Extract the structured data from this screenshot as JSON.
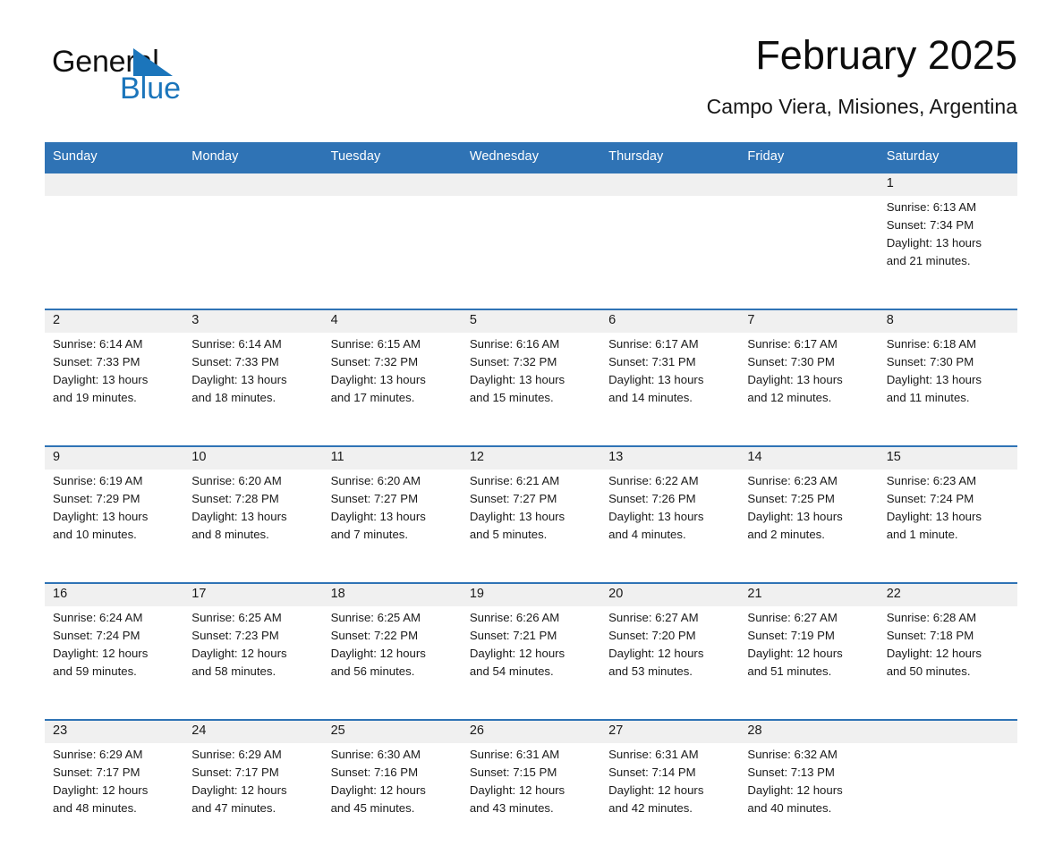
{
  "logo": {
    "word_one": "General",
    "word_two": "Blue",
    "triangle_icon": "triangle-icon",
    "brand_color": "#1b75bb"
  },
  "header": {
    "title": "February 2025",
    "subtitle": "Campo Viera, Misiones, Argentina"
  },
  "theme": {
    "header_blue": "#2f73b5",
    "daynum_strip": "#f0f0f0",
    "cell_background": "#ffffff"
  },
  "weekday_headers": [
    "Sunday",
    "Monday",
    "Tuesday",
    "Wednesday",
    "Thursday",
    "Friday",
    "Saturday"
  ],
  "weeks": [
    {
      "days": [
        {
          "num": "",
          "lines": []
        },
        {
          "num": "",
          "lines": []
        },
        {
          "num": "",
          "lines": []
        },
        {
          "num": "",
          "lines": []
        },
        {
          "num": "",
          "lines": []
        },
        {
          "num": "",
          "lines": []
        },
        {
          "num": "1",
          "lines": [
            "Sunrise: 6:13 AM",
            "Sunset: 7:34 PM",
            "Daylight: 13 hours",
            "and 21 minutes."
          ]
        }
      ]
    },
    {
      "days": [
        {
          "num": "2",
          "lines": [
            "Sunrise: 6:14 AM",
            "Sunset: 7:33 PM",
            "Daylight: 13 hours",
            "and 19 minutes."
          ]
        },
        {
          "num": "3",
          "lines": [
            "Sunrise: 6:14 AM",
            "Sunset: 7:33 PM",
            "Daylight: 13 hours",
            "and 18 minutes."
          ]
        },
        {
          "num": "4",
          "lines": [
            "Sunrise: 6:15 AM",
            "Sunset: 7:32 PM",
            "Daylight: 13 hours",
            "and 17 minutes."
          ]
        },
        {
          "num": "5",
          "lines": [
            "Sunrise: 6:16 AM",
            "Sunset: 7:32 PM",
            "Daylight: 13 hours",
            "and 15 minutes."
          ]
        },
        {
          "num": "6",
          "lines": [
            "Sunrise: 6:17 AM",
            "Sunset: 7:31 PM",
            "Daylight: 13 hours",
            "and 14 minutes."
          ]
        },
        {
          "num": "7",
          "lines": [
            "Sunrise: 6:17 AM",
            "Sunset: 7:30 PM",
            "Daylight: 13 hours",
            "and 12 minutes."
          ]
        },
        {
          "num": "8",
          "lines": [
            "Sunrise: 6:18 AM",
            "Sunset: 7:30 PM",
            "Daylight: 13 hours",
            "and 11 minutes."
          ]
        }
      ]
    },
    {
      "days": [
        {
          "num": "9",
          "lines": [
            "Sunrise: 6:19 AM",
            "Sunset: 7:29 PM",
            "Daylight: 13 hours",
            "and 10 minutes."
          ]
        },
        {
          "num": "10",
          "lines": [
            "Sunrise: 6:20 AM",
            "Sunset: 7:28 PM",
            "Daylight: 13 hours",
            "and 8 minutes."
          ]
        },
        {
          "num": "11",
          "lines": [
            "Sunrise: 6:20 AM",
            "Sunset: 7:27 PM",
            "Daylight: 13 hours",
            "and 7 minutes."
          ]
        },
        {
          "num": "12",
          "lines": [
            "Sunrise: 6:21 AM",
            "Sunset: 7:27 PM",
            "Daylight: 13 hours",
            "and 5 minutes."
          ]
        },
        {
          "num": "13",
          "lines": [
            "Sunrise: 6:22 AM",
            "Sunset: 7:26 PM",
            "Daylight: 13 hours",
            "and 4 minutes."
          ]
        },
        {
          "num": "14",
          "lines": [
            "Sunrise: 6:23 AM",
            "Sunset: 7:25 PM",
            "Daylight: 13 hours",
            "and 2 minutes."
          ]
        },
        {
          "num": "15",
          "lines": [
            "Sunrise: 6:23 AM",
            "Sunset: 7:24 PM",
            "Daylight: 13 hours",
            "and 1 minute."
          ]
        }
      ]
    },
    {
      "days": [
        {
          "num": "16",
          "lines": [
            "Sunrise: 6:24 AM",
            "Sunset: 7:24 PM",
            "Daylight: 12 hours",
            "and 59 minutes."
          ]
        },
        {
          "num": "17",
          "lines": [
            "Sunrise: 6:25 AM",
            "Sunset: 7:23 PM",
            "Daylight: 12 hours",
            "and 58 minutes."
          ]
        },
        {
          "num": "18",
          "lines": [
            "Sunrise: 6:25 AM",
            "Sunset: 7:22 PM",
            "Daylight: 12 hours",
            "and 56 minutes."
          ]
        },
        {
          "num": "19",
          "lines": [
            "Sunrise: 6:26 AM",
            "Sunset: 7:21 PM",
            "Daylight: 12 hours",
            "and 54 minutes."
          ]
        },
        {
          "num": "20",
          "lines": [
            "Sunrise: 6:27 AM",
            "Sunset: 7:20 PM",
            "Daylight: 12 hours",
            "and 53 minutes."
          ]
        },
        {
          "num": "21",
          "lines": [
            "Sunrise: 6:27 AM",
            "Sunset: 7:19 PM",
            "Daylight: 12 hours",
            "and 51 minutes."
          ]
        },
        {
          "num": "22",
          "lines": [
            "Sunrise: 6:28 AM",
            "Sunset: 7:18 PM",
            "Daylight: 12 hours",
            "and 50 minutes."
          ]
        }
      ]
    },
    {
      "days": [
        {
          "num": "23",
          "lines": [
            "Sunrise: 6:29 AM",
            "Sunset: 7:17 PM",
            "Daylight: 12 hours",
            "and 48 minutes."
          ]
        },
        {
          "num": "24",
          "lines": [
            "Sunrise: 6:29 AM",
            "Sunset: 7:17 PM",
            "Daylight: 12 hours",
            "and 47 minutes."
          ]
        },
        {
          "num": "25",
          "lines": [
            "Sunrise: 6:30 AM",
            "Sunset: 7:16 PM",
            "Daylight: 12 hours",
            "and 45 minutes."
          ]
        },
        {
          "num": "26",
          "lines": [
            "Sunrise: 6:31 AM",
            "Sunset: 7:15 PM",
            "Daylight: 12 hours",
            "and 43 minutes."
          ]
        },
        {
          "num": "27",
          "lines": [
            "Sunrise: 6:31 AM",
            "Sunset: 7:14 PM",
            "Daylight: 12 hours",
            "and 42 minutes."
          ]
        },
        {
          "num": "28",
          "lines": [
            "Sunrise: 6:32 AM",
            "Sunset: 7:13 PM",
            "Daylight: 12 hours",
            "and 40 minutes."
          ]
        },
        {
          "num": "",
          "lines": []
        }
      ]
    }
  ]
}
